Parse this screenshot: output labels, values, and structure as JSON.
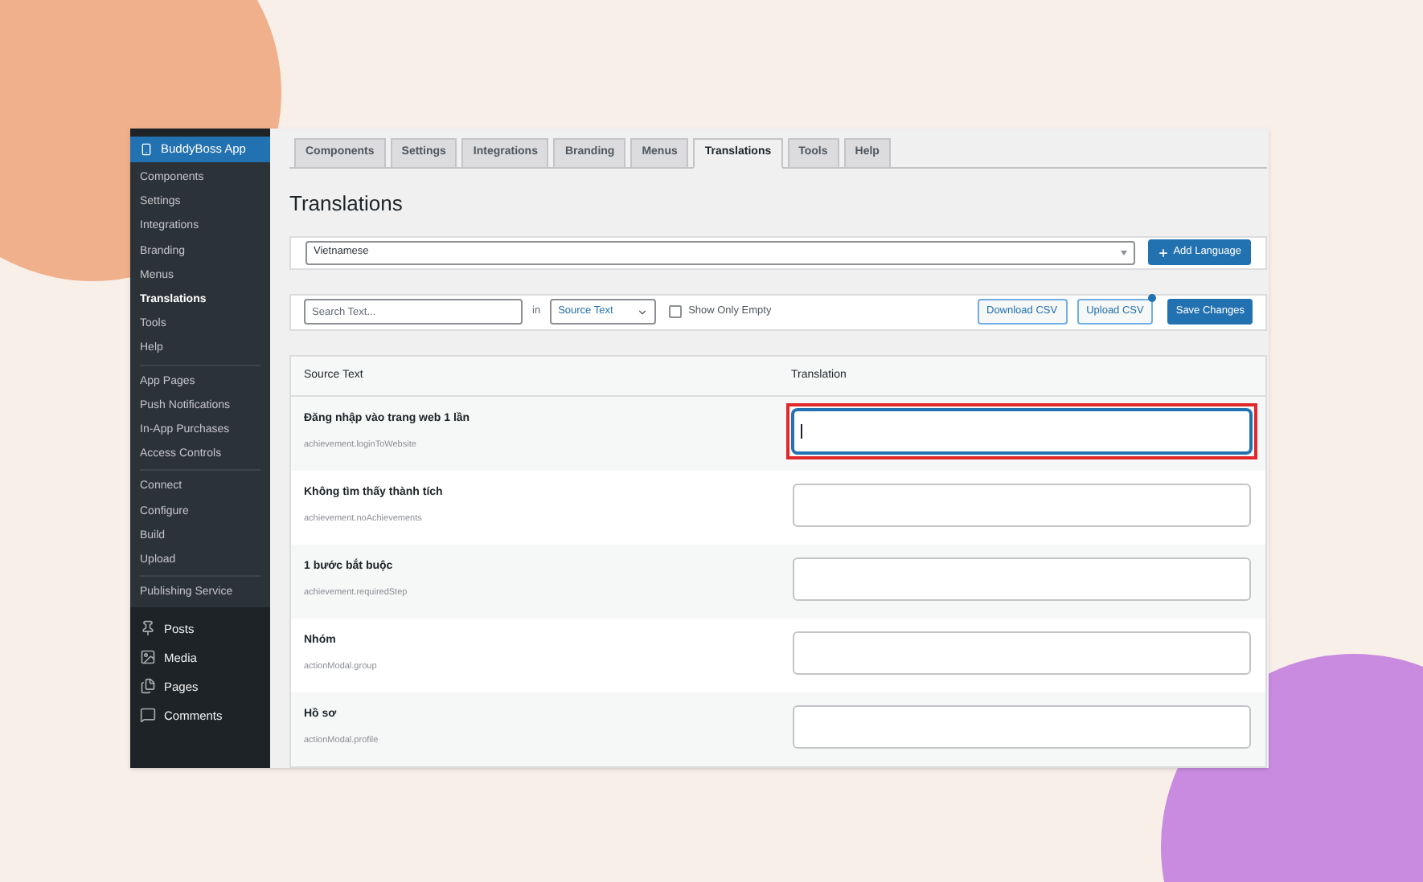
{
  "sidebar": {
    "app_title": "BuddyBoss App",
    "groups": [
      {
        "items": [
          {
            "label": "Components",
            "selected": false
          },
          {
            "label": "Settings",
            "selected": false
          },
          {
            "label": "Integrations",
            "selected": false
          },
          {
            "label": "Branding",
            "selected": false
          },
          {
            "label": "Menus",
            "selected": false
          },
          {
            "label": "Translations",
            "selected": true
          },
          {
            "label": "Tools",
            "selected": false
          },
          {
            "label": "Help",
            "selected": false
          }
        ]
      },
      {
        "items": [
          {
            "label": "App Pages",
            "selected": false
          },
          {
            "label": "Push Notifications",
            "selected": false
          },
          {
            "label": "In-App Purchases",
            "selected": false
          },
          {
            "label": "Access Controls",
            "selected": false
          }
        ]
      },
      {
        "items": [
          {
            "label": "Connect",
            "selected": false
          },
          {
            "label": "Configure",
            "selected": false
          },
          {
            "label": "Build",
            "selected": false
          },
          {
            "label": "Upload",
            "selected": false
          }
        ]
      },
      {
        "items": [
          {
            "label": "Publishing Service",
            "selected": false
          }
        ]
      }
    ],
    "menu": [
      {
        "label": "Posts",
        "kind": "pin"
      },
      {
        "label": "Media",
        "kind": "media"
      },
      {
        "label": "Pages",
        "kind": "pages"
      },
      {
        "label": "Comments",
        "kind": "comment"
      }
    ]
  },
  "tabs": [
    {
      "label": "Components",
      "selected": false
    },
    {
      "label": "Settings",
      "selected": false
    },
    {
      "label": "Integrations",
      "selected": false
    },
    {
      "label": "Branding",
      "selected": false
    },
    {
      "label": "Menus",
      "selected": false
    },
    {
      "label": "Translations",
      "selected": true
    },
    {
      "label": "Tools",
      "selected": false
    },
    {
      "label": "Help",
      "selected": false
    }
  ],
  "heading": "Translations",
  "language": {
    "value": "Vietnamese",
    "add_button": "Add Language"
  },
  "filter": {
    "search_placeholder": "Search Text...",
    "in_label": "in",
    "scope": "Source Text",
    "show_only_empty": {
      "label": "Show Only Empty",
      "checked": false
    },
    "download_button": "Download CSV",
    "upload_button": "Upload CSV",
    "save_button": "Save Changes"
  },
  "table": {
    "columns": [
      "Source Text",
      "Translation"
    ],
    "rows": [
      {
        "text": "Đăng nhập vào trang web 1 lần",
        "key": "achievement.loginToWebsite",
        "focused": true,
        "highlighted": true
      },
      {
        "text": "Không tìm thấy thành tích",
        "key": "achievement.noAchievements",
        "focused": false,
        "highlighted": false
      },
      {
        "text": "1 bước bắt buộc",
        "key": "achievement.requiredStep",
        "focused": false,
        "highlighted": false
      },
      {
        "text": "Nhóm",
        "key": "actionModal.group",
        "focused": false,
        "highlighted": false
      },
      {
        "text": "Hồ sơ",
        "key": "actionModal.profile",
        "focused": false,
        "highlighted": false
      }
    ]
  }
}
